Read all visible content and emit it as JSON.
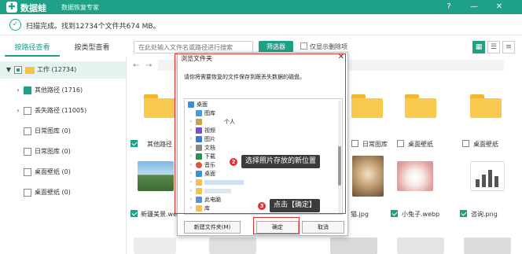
{
  "app": {
    "brand": "数据蛙",
    "subtitle": "数据恢复专家",
    "logo_glyph": "✚"
  },
  "status": {
    "text": "扫描完成。",
    "count_text": "找到12734个文件共674 MB。"
  },
  "tabs": [
    {
      "label": "按路径查看",
      "active": true
    },
    {
      "label": "按类型查看",
      "active": false
    }
  ],
  "search": {
    "placeholder": "在此处输入文件名或路径进行搜索"
  },
  "filter_button": "筛选器",
  "only_deleted": "仅显示删除项",
  "tree": [
    {
      "label": "工作 (12734)",
      "arrow": "▼",
      "check": "partial",
      "selected": true
    },
    {
      "label": "其他路径 (1716)",
      "arrow": "›",
      "check": "checked"
    },
    {
      "label": "丢失路径 (11005)",
      "arrow": "›",
      "check": "none"
    },
    {
      "label": "日常图库 (0)",
      "arrow": "",
      "check": "none"
    },
    {
      "label": "日常图库 (0)",
      "arrow": "",
      "check": "none"
    },
    {
      "label": "桌面壁纸 (0)",
      "arrow": "",
      "check": "none"
    },
    {
      "label": "桌面壁纸 (0)",
      "arrow": "",
      "check": "none"
    }
  ],
  "files_row1": [
    {
      "label": "其他路径",
      "checked": true
    },
    {
      "label": "日常图库",
      "checked": false
    },
    {
      "label": "桌面壁纸",
      "checked": false
    },
    {
      "label": "桌面壁纸",
      "checked": false
    }
  ],
  "files_row2": [
    {
      "label": "新疆美景.web",
      "checked": true
    },
    {
      "label": "猫.jpg",
      "checked": false
    },
    {
      "label": "小兔子.webp",
      "checked": true
    },
    {
      "label": "咨询.png",
      "checked": true
    }
  ],
  "dialog": {
    "title": "浏览文件夹",
    "close": "✕",
    "description": "请你将需要恢复的文件保存到跟丢失数据的磁盘。",
    "items": [
      {
        "label": "桌面",
        "arrow": "",
        "color": "#3b8fd6",
        "indent": 0
      },
      {
        "label": "图库",
        "arrow": "",
        "color": "#4a9ad8",
        "indent": 1
      },
      {
        "label": "个人",
        "arrow": "›",
        "color": "#c9a24a",
        "indent": 1
      },
      {
        "label": "视频",
        "arrow": "›",
        "color": "#7a4fcf",
        "indent": 1
      },
      {
        "label": "图片",
        "arrow": "›",
        "color": "#3a7bd5",
        "indent": 1
      },
      {
        "label": "文档",
        "arrow": "›",
        "color": "#888888",
        "indent": 1
      },
      {
        "label": "下载",
        "arrow": "›",
        "color": "#2d8f4e",
        "indent": 1
      },
      {
        "label": "音乐",
        "arrow": "›",
        "color": "#e0553b",
        "indent": 1
      },
      {
        "label": "桌面",
        "arrow": "›",
        "color": "#3b8fd6",
        "indent": 1
      },
      {
        "label": "",
        "arrow": "›",
        "color": "#f2c14e",
        "indent": 1
      },
      {
        "label": "",
        "arrow": "›",
        "color": "#f2c14e",
        "indent": 1
      },
      {
        "label": "此电脑",
        "arrow": "›",
        "color": "#5a8fd6",
        "indent": 1
      },
      {
        "label": "库",
        "arrow": "›",
        "color": "#f2c14e",
        "indent": 1
      }
    ],
    "new_folder": "新建文件夹(M)",
    "ok": "确定",
    "cancel": "取消"
  },
  "callouts": [
    {
      "num": "2",
      "text": "选择照片存放的新位置"
    },
    {
      "num": "3",
      "text": "点击【确定】"
    }
  ],
  "colors": {
    "accent": "#1fa187",
    "annotation_red": "#e03030"
  }
}
